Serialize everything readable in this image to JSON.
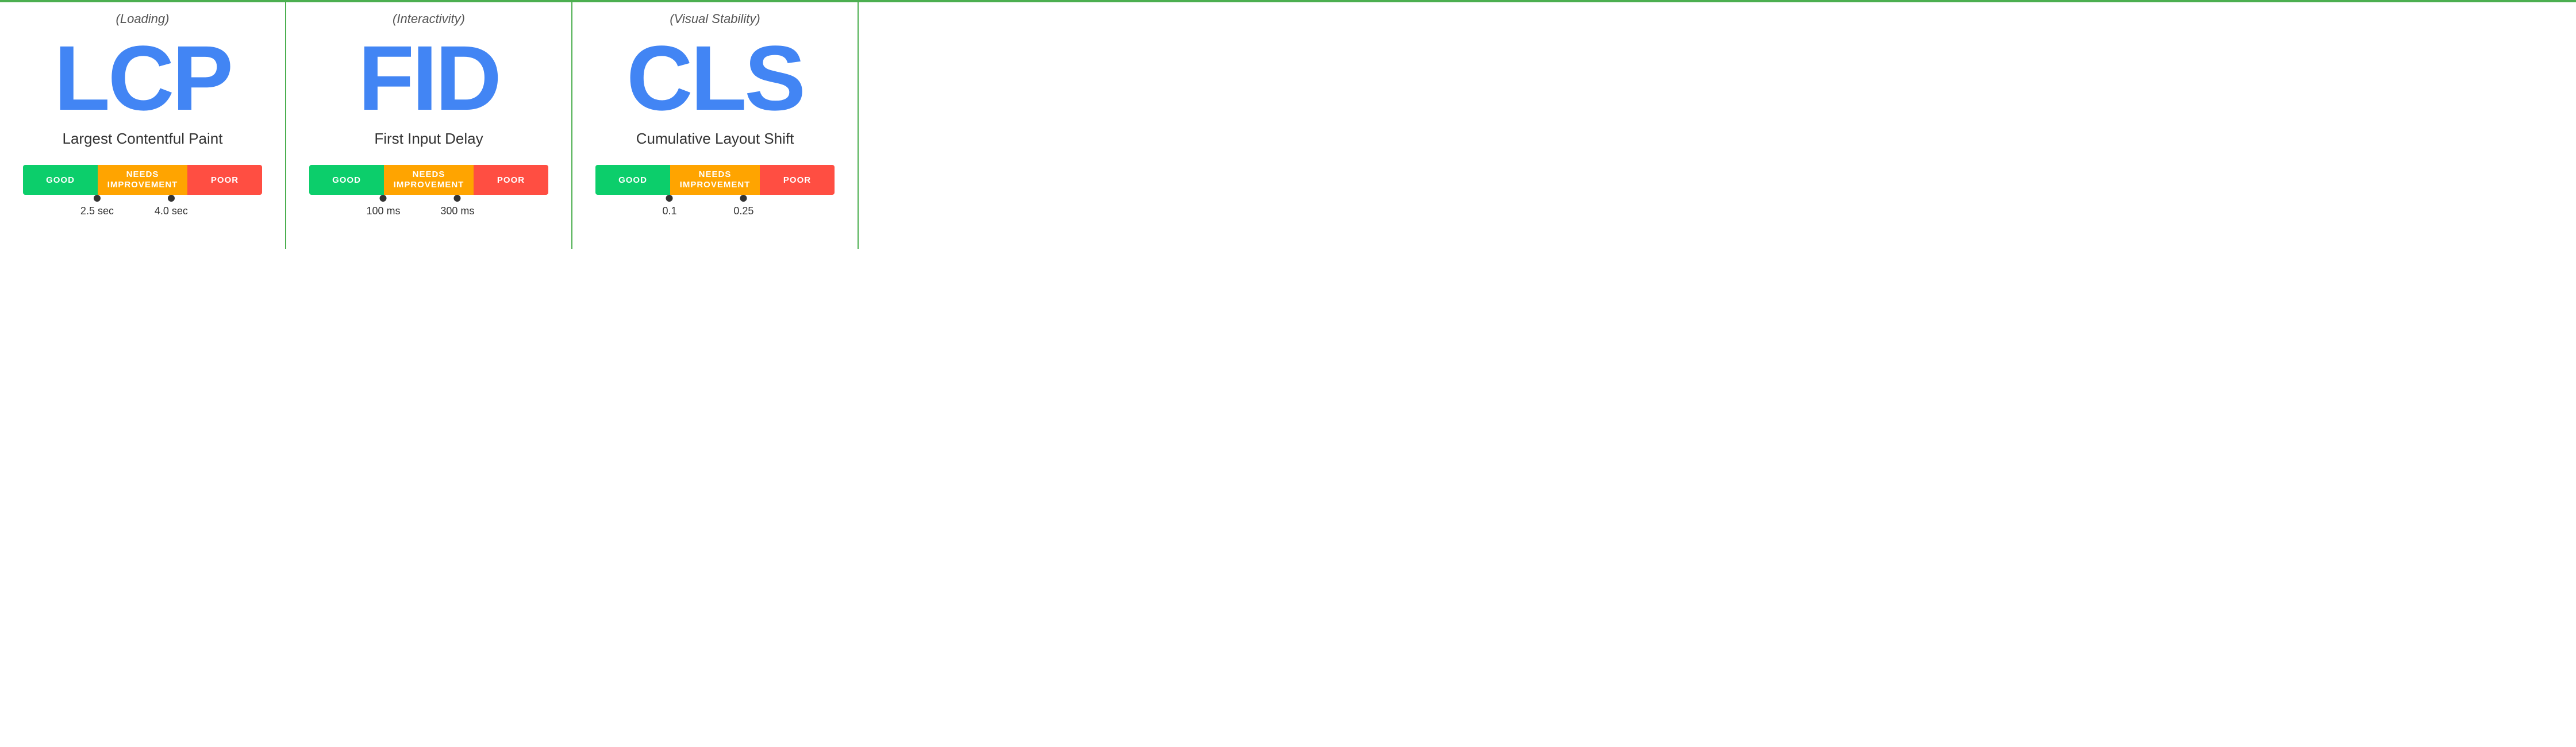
{
  "panels": [
    {
      "id": "lcp",
      "subtitle": "(Loading)",
      "acronym": "LCP",
      "fullname": "Largest Contentful Paint",
      "bar": {
        "good": "GOOD",
        "needs": "NEEDS\nIMPROVEMENT",
        "poor": "POOR"
      },
      "markers": [
        {
          "label": "2.5 sec",
          "position_pct": 31
        },
        {
          "label": "4.0 sec",
          "position_pct": 62
        }
      ]
    },
    {
      "id": "fid",
      "subtitle": "(Interactivity)",
      "acronym": "FID",
      "fullname": "First Input Delay",
      "bar": {
        "good": "GOOD",
        "needs": "NEEDS\nIMPROVEMENT",
        "poor": "POOR"
      },
      "markers": [
        {
          "label": "100 ms",
          "position_pct": 31
        },
        {
          "label": "300 ms",
          "position_pct": 62
        }
      ]
    },
    {
      "id": "cls",
      "subtitle": "(Visual Stability)",
      "acronym": "CLS",
      "fullname": "Cumulative Layout Shift",
      "bar": {
        "good": "GOOD",
        "needs": "NEEDS\nIMPROVEMENT",
        "poor": "POOR"
      },
      "markers": [
        {
          "label": "0.1",
          "position_pct": 31
        },
        {
          "label": "0.25",
          "position_pct": 62
        }
      ]
    }
  ]
}
